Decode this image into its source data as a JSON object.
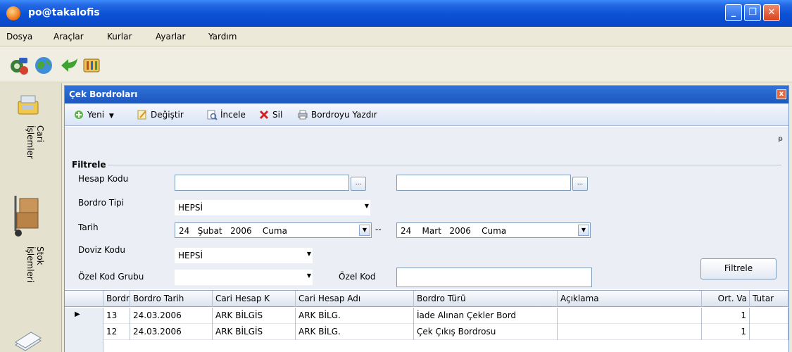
{
  "window": {
    "title": "po@takalofis"
  },
  "menu": [
    "Dosya",
    "Araçlar",
    "Kurlar",
    "Ayarlar",
    "Yardım"
  ],
  "main_toolbar_icons": [
    "tools-gear-icon",
    "globe-icon",
    "green-arrow-icon",
    "settings-chip-icon"
  ],
  "sidebar": {
    "items": [
      {
        "label": "Cari İşlemler",
        "icon": "cash-register-icon"
      },
      {
        "label": "Stok İşlemleri",
        "icon": "hand-truck-icon"
      },
      {
        "label": "",
        "icon": "documents-icon"
      }
    ]
  },
  "child_window": {
    "title": "Çek Bordroları",
    "toolbar": {
      "new": "Yeni",
      "edit": "Değiştir",
      "inspect": "İncele",
      "delete": "Sil",
      "print": "Bordroyu Yazdır"
    },
    "filter": {
      "legend": "Filtrele",
      "hesap_kodu_label": "Hesap Kodu",
      "hesap_kodu_from": "",
      "hesap_kodu_to": "",
      "ellipsis": "...",
      "bordro_tipi_label": "Bordro Tipi",
      "bordro_tipi_value": "HEPSİ",
      "tarih_label": "Tarih",
      "tarih_from": {
        "day": "24",
        "month": "Şubat",
        "year": "2006",
        "weekday": "Cuma"
      },
      "tarih_sep": "--",
      "tarih_to": {
        "day": "24",
        "month": "Mart",
        "year": "2006",
        "weekday": "Cuma"
      },
      "doviz_kodu_label": "Doviz Kodu",
      "doviz_kodu_value": "HEPSİ",
      "ozel_kod_grubu_label": "Özel Kod Grubu",
      "ozel_kod_grubu_value": "",
      "ozel_kod_label": "Özel Kod",
      "ozel_kod_value": "",
      "apply_button": "Filtrele"
    },
    "grid": {
      "columns": [
        "Bordr",
        "Bordro Tarih",
        "Cari Hesap K",
        "Cari Hesap Adı",
        "Bordro Türü",
        "Açıklama",
        "Ort. Va",
        "Tutar"
      ],
      "rows": [
        [
          "13",
          "24.03.2006",
          "ARK BİLGİS",
          "ARK BİLG.",
          "İade Alınan Çekler Bord",
          "",
          "1",
          ""
        ],
        [
          "12",
          "24.03.2006",
          "ARK BİLGİS",
          "ARK BİLG.",
          "Çek Çıkış Bordrosu",
          "",
          "1",
          ""
        ]
      ]
    }
  },
  "colors": {
    "titlebar": "#0b51d6",
    "child_titlebar": "#1d56c0",
    "panel": "#ece9d8"
  }
}
